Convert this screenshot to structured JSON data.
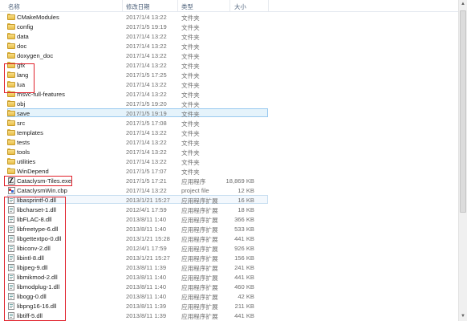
{
  "columns": {
    "name": "名称",
    "date": "修改日期",
    "type": "类型",
    "size": "大小"
  },
  "files": [
    {
      "name": "CMakeModules",
      "date": "2017/1/4 13:22",
      "type": "文件夹",
      "size": "",
      "icon": "folder-icon"
    },
    {
      "name": "config",
      "date": "2017/1/5 19:19",
      "type": "文件夹",
      "size": "",
      "icon": "folder-icon"
    },
    {
      "name": "data",
      "date": "2017/1/4 13:22",
      "type": "文件夹",
      "size": "",
      "icon": "folder-icon"
    },
    {
      "name": "doc",
      "date": "2017/1/4 13:22",
      "type": "文件夹",
      "size": "",
      "icon": "folder-icon"
    },
    {
      "name": "doxygen_doc",
      "date": "2017/1/4 13:22",
      "type": "文件夹",
      "size": "",
      "icon": "folder-icon"
    },
    {
      "name": "gfx",
      "date": "2017/1/4 13:22",
      "type": "文件夹",
      "size": "",
      "icon": "folder-icon"
    },
    {
      "name": "lang",
      "date": "2017/1/5 17:25",
      "type": "文件夹",
      "size": "",
      "icon": "folder-icon"
    },
    {
      "name": "lua",
      "date": "2017/1/4 13:22",
      "type": "文件夹",
      "size": "",
      "icon": "folder-icon"
    },
    {
      "name": "msvc-full-features",
      "date": "2017/1/4 13:22",
      "type": "文件夹",
      "size": "",
      "icon": "folder-icon"
    },
    {
      "name": "obj",
      "date": "2017/1/5 19:20",
      "type": "文件夹",
      "size": "",
      "icon": "folder-icon"
    },
    {
      "name": "save",
      "date": "2017/1/5 19:19",
      "type": "文件夹",
      "size": "",
      "icon": "folder-icon",
      "highlight": true
    },
    {
      "name": "src",
      "date": "2017/1/5 17:08",
      "type": "文件夹",
      "size": "",
      "icon": "folder-icon"
    },
    {
      "name": "templates",
      "date": "2017/1/4 13:22",
      "type": "文件夹",
      "size": "",
      "icon": "folder-icon"
    },
    {
      "name": "tests",
      "date": "2017/1/4 13:22",
      "type": "文件夹",
      "size": "",
      "icon": "folder-icon"
    },
    {
      "name": "tools",
      "date": "2017/1/4 13:22",
      "type": "文件夹",
      "size": "",
      "icon": "folder-icon"
    },
    {
      "name": "utilities",
      "date": "2017/1/4 13:22",
      "type": "文件夹",
      "size": "",
      "icon": "folder-icon"
    },
    {
      "name": "WinDepend",
      "date": "2017/1/5 17:07",
      "type": "文件夹",
      "size": "",
      "icon": "folder-icon"
    },
    {
      "name": "Cataclysm-Tiles.exe",
      "date": "2017/1/5 17:21",
      "type": "应用程序",
      "size": "18,869 KB",
      "icon": "exe-icon"
    },
    {
      "name": "CataclysmWin.cbp",
      "date": "2017/1/4 13:22",
      "type": "project file",
      "size": "12 KB",
      "icon": "cbp-icon"
    },
    {
      "name": "libasprintf-0.dll",
      "date": "2013/1/21 15:27",
      "type": "应用程序扩展",
      "size": "16 KB",
      "icon": "dll-icon",
      "highlight2": true
    },
    {
      "name": "libcharset-1.dll",
      "date": "2012/4/1 17:59",
      "type": "应用程序扩展",
      "size": "18 KB",
      "icon": "dll-icon"
    },
    {
      "name": "libFLAC-8.dll",
      "date": "2013/8/11 1:40",
      "type": "应用程序扩展",
      "size": "366 KB",
      "icon": "dll-icon"
    },
    {
      "name": "libfreetype-6.dll",
      "date": "2013/8/11 1:40",
      "type": "应用程序扩展",
      "size": "533 KB",
      "icon": "dll-icon"
    },
    {
      "name": "libgettextpo-0.dll",
      "date": "2013/1/21 15:28",
      "type": "应用程序扩展",
      "size": "441 KB",
      "icon": "dll-icon"
    },
    {
      "name": "libiconv-2.dll",
      "date": "2012/4/1 17:59",
      "type": "应用程序扩展",
      "size": "926 KB",
      "icon": "dll-icon"
    },
    {
      "name": "libintl-8.dll",
      "date": "2013/1/21 15:27",
      "type": "应用程序扩展",
      "size": "156 KB",
      "icon": "dll-icon"
    },
    {
      "name": "libjpeg-9.dll",
      "date": "2013/8/11 1:39",
      "type": "应用程序扩展",
      "size": "241 KB",
      "icon": "dll-icon"
    },
    {
      "name": "libmikmod-2.dll",
      "date": "2013/8/11 1:40",
      "type": "应用程序扩展",
      "size": "441 KB",
      "icon": "dll-icon"
    },
    {
      "name": "libmodplug-1.dll",
      "date": "2013/8/11 1:40",
      "type": "应用程序扩展",
      "size": "460 KB",
      "icon": "dll-icon"
    },
    {
      "name": "libogg-0.dll",
      "date": "2013/8/11 1:40",
      "type": "应用程序扩展",
      "size": "42 KB",
      "icon": "dll-icon"
    },
    {
      "name": "libpng16-16.dll",
      "date": "2013/8/11 1:39",
      "type": "应用程序扩展",
      "size": "211 KB",
      "icon": "dll-icon"
    },
    {
      "name": "libtiff-5.dll",
      "date": "2013/8/11 1:39",
      "type": "应用程序扩展",
      "size": "441 KB",
      "icon": "dll-icon"
    }
  ],
  "annotation_color": "#e0202a"
}
